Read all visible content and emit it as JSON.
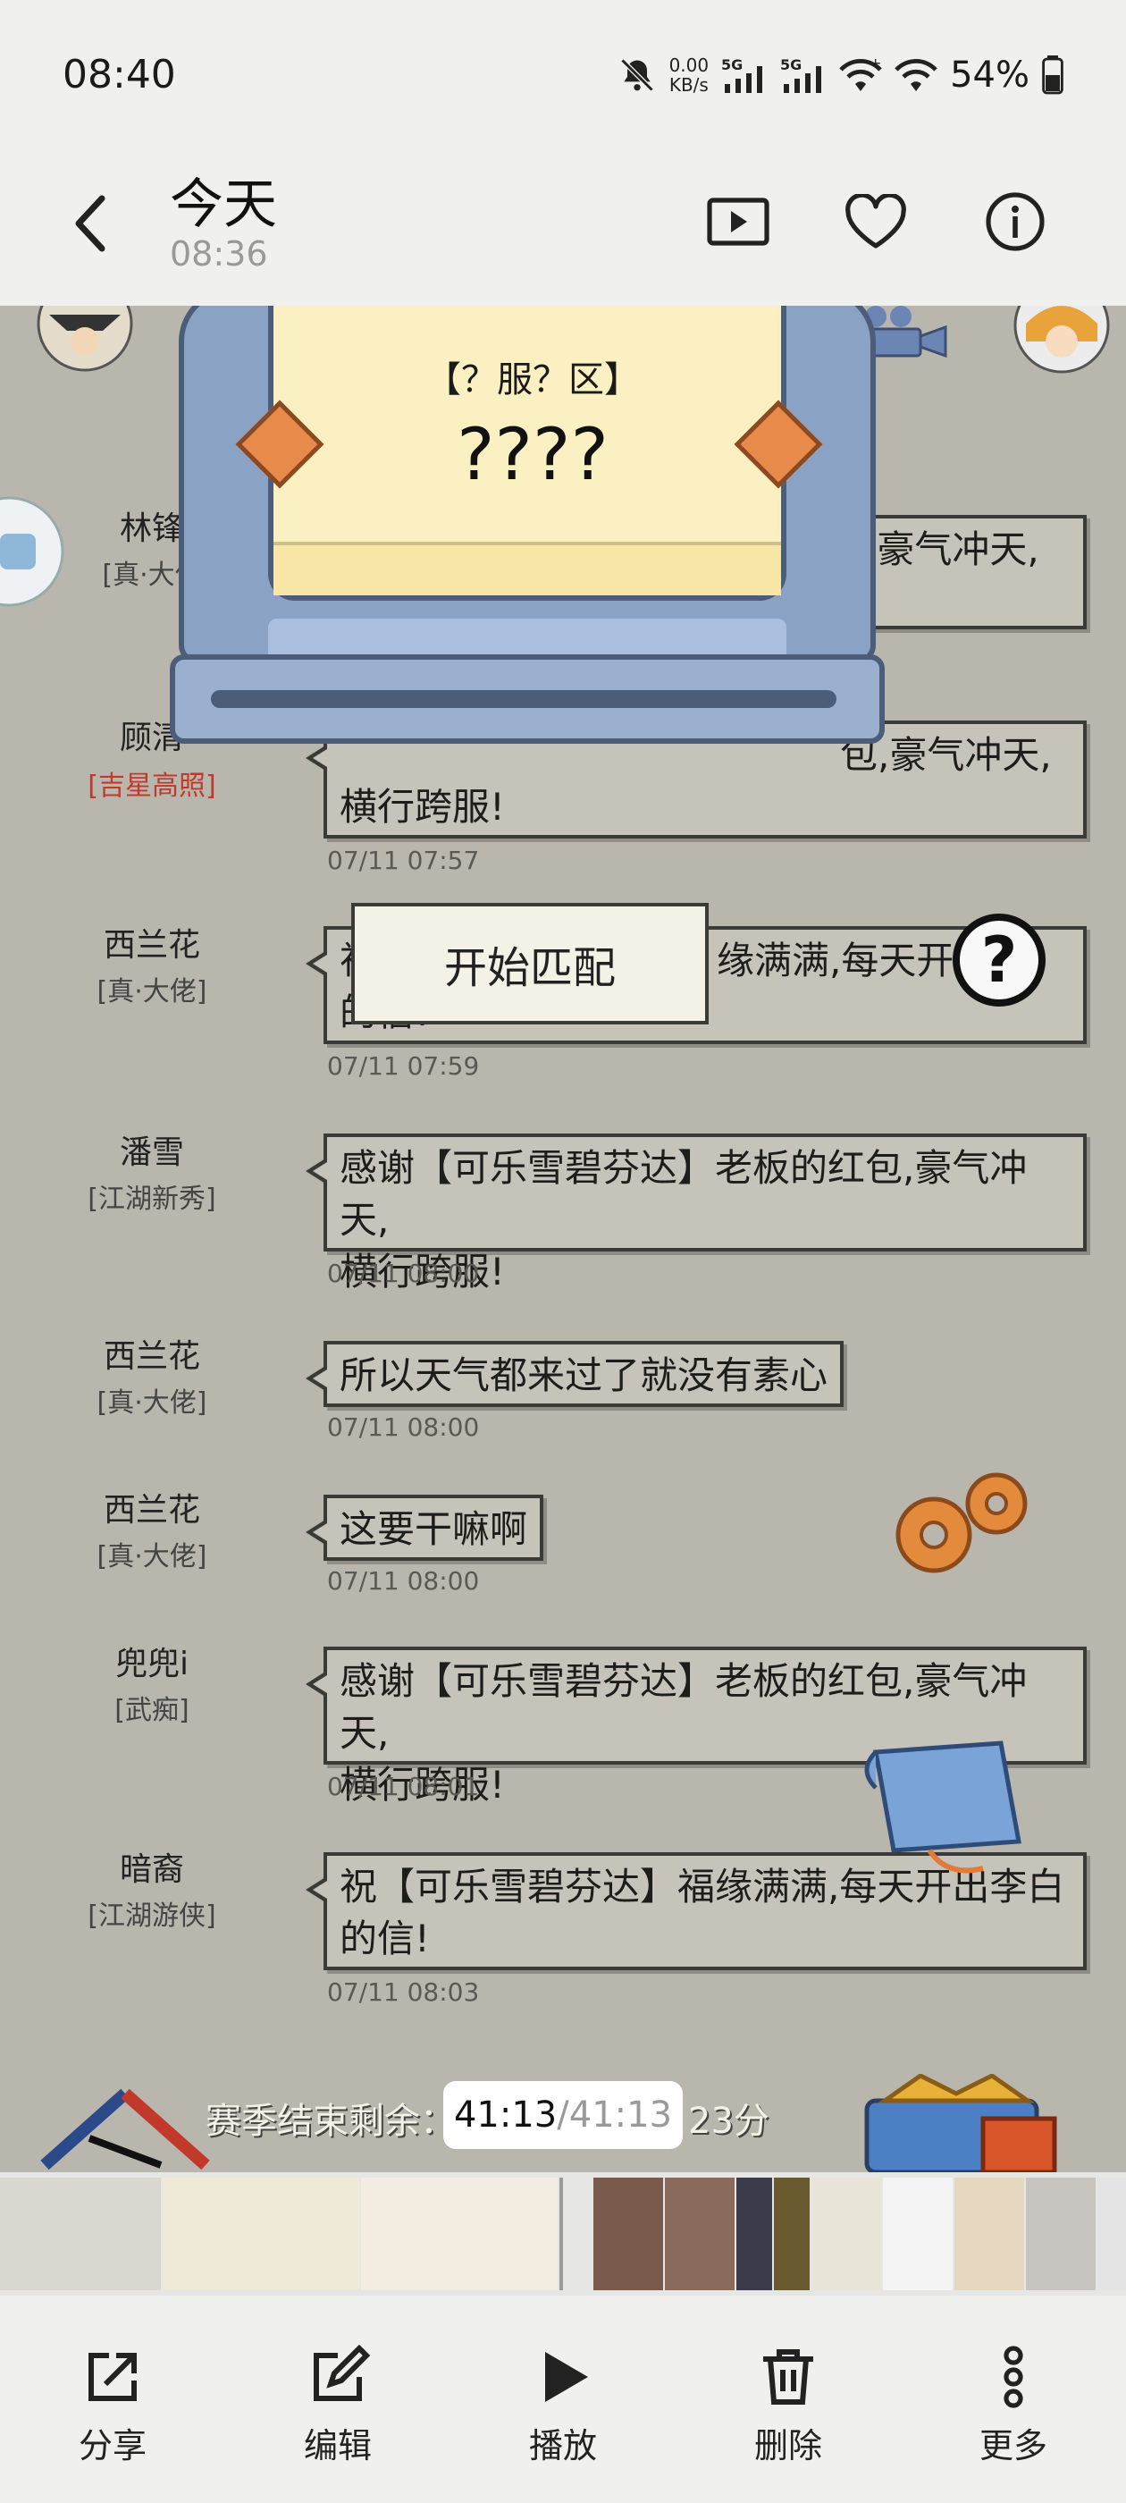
{
  "status_bar": {
    "time": "08:40",
    "net_speed_value": "0.00",
    "net_speed_unit": "KB/s",
    "sim1": "5G",
    "sim2": "5G",
    "battery": "54%"
  },
  "header": {
    "title": "今天",
    "subtitle": "08:36",
    "icons": [
      "back-icon",
      "slideshow-icon",
      "heart-icon",
      "info-icon"
    ]
  },
  "game": {
    "server_label": "【？服？区】",
    "server_name": "????",
    "match_button": "开始匹配",
    "help": "?",
    "season_text": "赛季结束剩余：",
    "season_remaining": "23分",
    "messages": [
      {
        "name": "林锋",
        "tag": "[真·大佬",
        "text": "包,豪气冲天,",
        "time": ""
      },
      {
        "name": "顾清",
        "tag": "[吉星高照]",
        "tag_color": "#c0392b",
        "text_line1": "包,豪气冲天,",
        "text_line2": "横行跨服!",
        "time": "07/11 07:57"
      },
      {
        "name": "西兰花",
        "tag": "[真·大佬]",
        "text_line1": "祝",
        "text_line1b": "缘满满,每天开",
        "text_line2": "的信!",
        "time": "07/11 07:59"
      },
      {
        "name": "潘雪",
        "tag": "[江湖新秀]",
        "text_line1": "感谢【可乐雪碧芬达】老板的红包,豪气冲天,",
        "text_line2": "横行跨服!",
        "time": "07/11 08:00"
      },
      {
        "name": "西兰花",
        "tag": "[真·大佬]",
        "text_line1": "所以天气都来过了就没有素心",
        "time": "07/11 08:00"
      },
      {
        "name": "西兰花",
        "tag": "[真·大佬]",
        "text_line1": "这要干嘛啊",
        "time": "07/11 08:00"
      },
      {
        "name": "兜兜i",
        "tag": "[武痴]",
        "text_line1": "感谢【可乐雪碧芬达】老板的红包,豪气冲天,",
        "text_line2": "横行跨服!",
        "time": "07/11 08:01"
      },
      {
        "name": "暗裔",
        "tag": "[江湖游侠]",
        "text_line1": "祝【可乐雪碧芬达】福缘满满,每天开出李白",
        "text_line2": "的信!",
        "time": "07/11 08:03"
      }
    ]
  },
  "video": {
    "current": "41:13",
    "total": "/41:13"
  },
  "bottom_actions": [
    {
      "label": "分享",
      "icon": "share-icon"
    },
    {
      "label": "编辑",
      "icon": "edit-icon"
    },
    {
      "label": "播放",
      "icon": "play-icon"
    },
    {
      "label": "删除",
      "icon": "delete-icon"
    },
    {
      "label": "更多",
      "icon": "more-icon"
    }
  ]
}
